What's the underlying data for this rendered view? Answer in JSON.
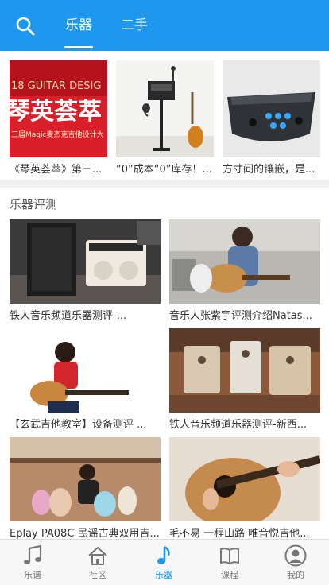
{
  "header": {
    "tabs": [
      {
        "label": "乐器",
        "active": true
      },
      {
        "label": "二手",
        "active": false
      }
    ],
    "accent": "#1e97ee"
  },
  "featured": [
    {
      "title": "《琴英荟萃》第三...",
      "overlay": "18 GUITAR DESIG",
      "overlay_big": "琴英荟萃",
      "overlay_small": "三届Magic麦杰克吉他设计大"
    },
    {
      "title": "“0”成本“0”库存！..."
    },
    {
      "title": "方寸间的镶嵌，是..."
    }
  ],
  "section": {
    "title": "乐器评测",
    "items": [
      {
        "title": "铁人音乐频道乐器测评-..."
      },
      {
        "title": "音乐人张紫宇评测介绍Natas..."
      },
      {
        "title": "【玄武吉他教室】设备测评 ..."
      },
      {
        "title": "铁人音乐频道乐器测评-新西..."
      },
      {
        "title": "Eplay PA08C 民谣古典双用吉..."
      },
      {
        "title": "毛不易 一程山路 唯音悦吉他..."
      }
    ]
  },
  "bottom_nav": [
    {
      "label": "乐谱",
      "icon": "music-note-icon",
      "active": false
    },
    {
      "label": "社区",
      "icon": "home-icon",
      "active": false
    },
    {
      "label": "乐器",
      "icon": "music-note-icon",
      "active": true
    },
    {
      "label": "课程",
      "icon": "book-icon",
      "active": false
    },
    {
      "label": "我的",
      "icon": "person-icon",
      "active": false
    }
  ]
}
